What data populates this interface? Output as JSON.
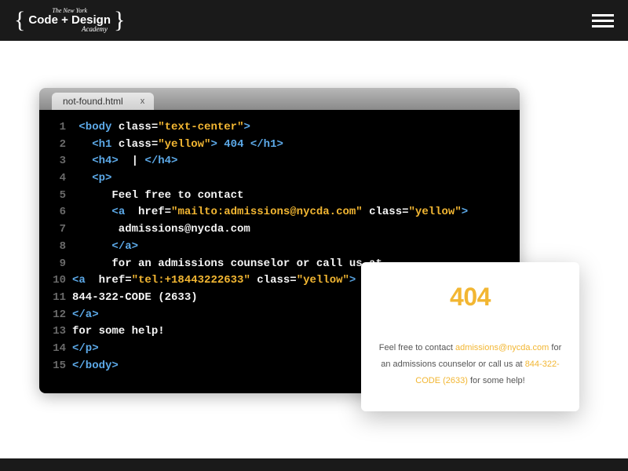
{
  "header": {
    "logo": {
      "line1": "The New York",
      "line2": "Code + Design",
      "line3": "Academy"
    }
  },
  "editor": {
    "tab": {
      "name": "not-found.html",
      "close": "x"
    },
    "lines": [
      {
        "n": "1",
        "segs": [
          [
            " ",
            "w"
          ],
          [
            "<body ",
            "b"
          ],
          [
            "class=",
            "w"
          ],
          [
            "\"text-center\"",
            "y"
          ],
          [
            ">",
            "b"
          ]
        ]
      },
      {
        "n": "2",
        "segs": [
          [
            "   ",
            "w"
          ],
          [
            "<h1 ",
            "b"
          ],
          [
            "class=",
            "w"
          ],
          [
            "\"yellow\"",
            "y"
          ],
          [
            "> 404 </h1>",
            "b"
          ]
        ]
      },
      {
        "n": "3",
        "segs": [
          [
            "   ",
            "w"
          ],
          [
            "<h4>",
            "b"
          ],
          [
            "  | ",
            "w"
          ],
          [
            "</h4>",
            "b"
          ]
        ]
      },
      {
        "n": "4",
        "segs": [
          [
            "   ",
            "w"
          ],
          [
            "<p>",
            "b"
          ]
        ]
      },
      {
        "n": "5",
        "segs": [
          [
            "      Feel free to contact",
            "w"
          ]
        ]
      },
      {
        "n": "6",
        "segs": [
          [
            "      ",
            "w"
          ],
          [
            "<a  ",
            "b"
          ],
          [
            "href=",
            "w"
          ],
          [
            "\"mailto:admissions@nycda.com\" ",
            "y"
          ],
          [
            "class=",
            "w"
          ],
          [
            "\"yellow\"",
            "y"
          ],
          [
            ">",
            "b"
          ]
        ]
      },
      {
        "n": "7",
        "segs": [
          [
            "       admissions@nycda.com",
            "w"
          ]
        ]
      },
      {
        "n": "8",
        "segs": [
          [
            "      ",
            "w"
          ],
          [
            "</a>",
            "b"
          ]
        ]
      },
      {
        "n": "9",
        "segs": [
          [
            "      for an admissions counselor or call us at",
            "w"
          ]
        ]
      },
      {
        "n": "10",
        "segs": [
          [
            "<a  ",
            "b"
          ],
          [
            "href=",
            "w"
          ],
          [
            "\"tel:+18443222633\" ",
            "y"
          ],
          [
            "class=",
            "w"
          ],
          [
            "\"yellow\"",
            "y"
          ],
          [
            ">",
            "b"
          ]
        ]
      },
      {
        "n": "11",
        "segs": [
          [
            "844-322-CODE (2633)",
            "w"
          ]
        ]
      },
      {
        "n": "12",
        "segs": [
          [
            "</a>",
            "b"
          ]
        ]
      },
      {
        "n": "13",
        "segs": [
          [
            "for some help!",
            "w"
          ]
        ]
      },
      {
        "n": "14",
        "segs": [
          [
            "</p>",
            "b"
          ]
        ]
      },
      {
        "n": "15",
        "segs": [
          [
            "</body>",
            "b"
          ]
        ]
      }
    ]
  },
  "card": {
    "title": "404",
    "text_1": "Feel free to contact ",
    "link_1": "admissions@nycda.com",
    "text_2": " for an admissions counselor or call us at ",
    "link_2": "844-322-CODE (2633)",
    "text_3": " for some help!"
  }
}
